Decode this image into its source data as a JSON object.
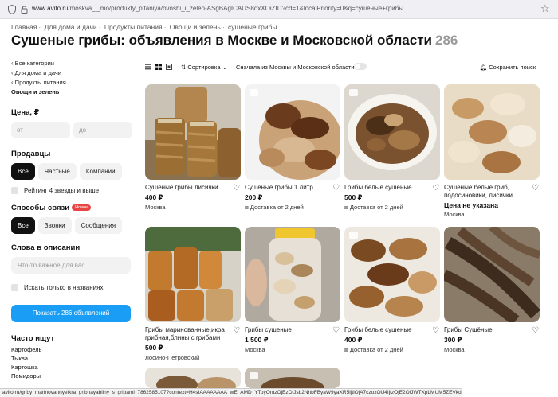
{
  "browser": {
    "url_domain": "www.avito.ru",
    "url_path": "/moskva_i_mo/produkty_pitaniya/ovoshi_i_zelen-ASgBAgICAUS8qxXOiZID?cd=1&localPriority=0&q=сушеные+грибы"
  },
  "breadcrumb": [
    "Главная",
    "Для дома и дачи",
    "Продукты питания",
    "Овощи и зелень",
    "сушеные грибы"
  ],
  "title": "Сушеные грибы: объявления в Москве и Московской области",
  "count": "286",
  "sidebar": {
    "categories": [
      "Все категории",
      "Для дома и дачи",
      "Продукты питания"
    ],
    "current": "Овощи и зелень",
    "price_head": "Цена, ₽",
    "price_from": "от",
    "price_to": "до",
    "sellers_head": "Продавцы",
    "sellers": [
      "Все",
      "Частные",
      "Компании"
    ],
    "rating": "Рейтинг 4 звезды и выше",
    "contact_head": "Способы связи",
    "new_badge": "Новое",
    "contacts": [
      "Все",
      "Звонки",
      "Сообщения"
    ],
    "words_head": "Слова в описании",
    "words_placeholder": "Что-то важное для вас",
    "titles_only": "Искать только в названиях",
    "show_button": "Показать 286 объявлений",
    "often_head": "Часто ищут",
    "often": [
      "Картофель",
      "Тыква",
      "Картошка",
      "Помидоры"
    ]
  },
  "toolbar": {
    "sort": "Сортировка",
    "moscow_first": "Сначала из Москвы и Московской области",
    "save_search": "Сохранить поиск"
  },
  "cards": [
    {
      "title": "Сушеные грибы лисички",
      "price": "400 ₽",
      "loc": "Москва",
      "delivery": false
    },
    {
      "title": "Сушеные грибы 1 литр",
      "price": "200 ₽",
      "loc": "Доставка от 2 дней",
      "delivery": true
    },
    {
      "title": "Грибы белые сушеные",
      "price": "500 ₽",
      "loc": "Доставка от 2 дней",
      "delivery": true
    },
    {
      "title": "Сушеные белые гриб, подосиновики, лисички",
      "price": "Цена не указана",
      "loc": "Москва",
      "delivery": false
    },
    {
      "title": "Грибы маринованные,икра грибная,блины с грибами",
      "price": "500 ₽",
      "loc": "Лосино-Петровский",
      "delivery": false
    },
    {
      "title": "Грибы сушеные",
      "price": "1 500 ₽",
      "loc": "Москва",
      "delivery": false
    },
    {
      "title": "Грибы белые сушеные",
      "price": "400 ₽",
      "loc": "Доставка от 2 дней",
      "delivery": true
    },
    {
      "title": "Грибы Сушёные",
      "price": "300 ₽",
      "loc": "Москва",
      "delivery": false
    }
  ],
  "status_url": "avito.ru/griby_marinovannyeikra_gribnayabliny_s_gribami_7862585107?context=H4sIAAAAAAAA_wE_AMD_YToyOntzOjEzOiJsb2NhbFByaW9yaXR5IjtiOjA7czoxOiJ4IjtzOjE2OiJWTXpLMUM5ZEVkdDqycm1HIjt9Jm9dhD8AAAA"
}
